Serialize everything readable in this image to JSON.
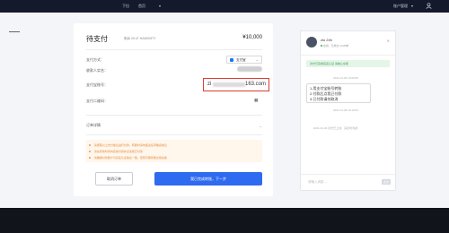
{
  "topbar": {
    "nav_b": "下拉",
    "nav_a": "首页",
    "nav_caret": "▾",
    "account": "账户管理",
    "account_caret": "▾"
  },
  "order": {
    "title": "待支付",
    "countdown": "剩余 09:47 HAMOMTY",
    "amount": "¥10,000",
    "method_label": "支付方式：",
    "method_value": "支付宝",
    "receiver_label": "收款人实名：",
    "account_label": "支付宝账号：",
    "account_prefix": "zi",
    "account_suffix": "163.com",
    "qr_label": "支付二维码：",
    "detail_label": "订单详情",
    "notices": [
      "· 请按照以上支付信息进行付款，转账时请勿备注任何敏感信息",
      "· 请在有效时间内完成付款并点击我已付款",
      "· 请确保付款账户与实名认证信息一致，否则可能导致交易失败"
    ],
    "cancel_label": "取消订单",
    "next_label": "我已完成转账，下一步"
  },
  "chat": {
    "name": "zlo 24h",
    "status": "在线  ·  已成交 1235单",
    "banner": "对方已完成实名认证  请放心交易",
    "time1": "2021-01-06 10:09:56",
    "bubble_lines": [
      "1.用支付宝账号转账",
      "2.付款后点我已付款",
      "3.已付款请勿取消"
    ],
    "time2": "2021-01-06 10:10:02",
    "system": "2021-01-06 对方已上线，请及时沟通",
    "input_placeholder": "请输入消息…",
    "send_label": "发送"
  },
  "icons": [
    "user-icon",
    "alipay-icon",
    "chevron-down-icon",
    "qr-icon",
    "close-icon"
  ],
  "colors": {
    "primary": "#2f6bf0",
    "highlight": "#e23a2f",
    "notice": "#e28b3a",
    "topbar": "#141a2b"
  }
}
